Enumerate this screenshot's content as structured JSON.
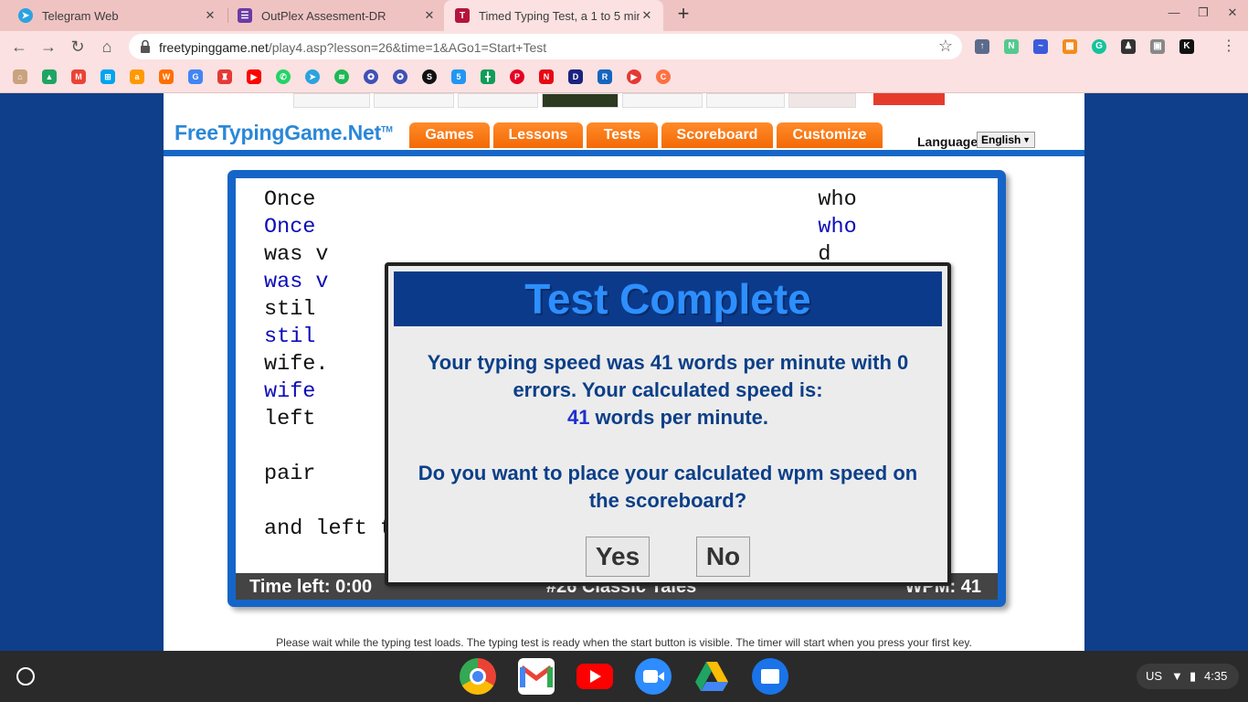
{
  "browser": {
    "tabs": [
      {
        "title": "Telegram Web",
        "icon": "telegram-icon",
        "color": "#2aa3e0",
        "active": false
      },
      {
        "title": "OutPlex Assesment-DR",
        "icon": "forms-icon",
        "color": "#6b3aa5",
        "active": false
      },
      {
        "title": "Timed Typing Test, a 1 to 5 minu",
        "icon": "typing-test-icon",
        "color": "#b5143c",
        "active": true
      }
    ],
    "url_domain": "freetypinggame.net",
    "url_path": "/play4.asp?lesson=26&time=1&AGo1=Start+Test"
  },
  "site": {
    "logo": "FreeTypingGame.Net",
    "logo_tm": "TM",
    "nav": [
      "Games",
      "Lessons",
      "Tests",
      "Scoreboard",
      "Customize"
    ],
    "language_label": "Language",
    "language_value": "English"
  },
  "typing": {
    "lines": [
      {
        "kind": "orig",
        "text": "Once                                       who"
      },
      {
        "kind": "typed",
        "text": "Once                                       who"
      },
      {
        "kind": "orig",
        "text": "was v                                      d"
      },
      {
        "kind": "typed",
        "text": "was v                                      d"
      },
      {
        "kind": "orig",
        "text": "stil                                       nd his"
      },
      {
        "kind": "typed",
        "text": "stil                                       nd his"
      },
      {
        "kind": "orig",
        "text": "wife.                                      g"
      },
      {
        "kind": "typed",
        "text": "wife                                        "
      },
      {
        "kind": "orig",
        "text": "left                                       e one"
      },
      {
        "kind": "orig",
        "text": "pair                                       itch,"
      },
      {
        "kind": "orig",
        "text": "and left them on the bench; then he said his prayers"
      }
    ],
    "status": {
      "time_left": "Time left: 0:00",
      "lesson": "#26 Classic Tales",
      "wpm": "WPM: 41"
    }
  },
  "dialog": {
    "title": "Test Complete",
    "line1": "Your typing speed was 41 words per minute with 0",
    "line2": "errors. Your calculated speed is:",
    "calc_speed": "41",
    "line3_suffix": " words per minute.",
    "question1": "Do you want to place your calculated wpm speed on",
    "question2": "the scoreboard?",
    "yes_label": "Yes",
    "no_label": "No"
  },
  "footer_message": "Please wait while the typing test loads. The typing test is ready when the start button is visible. The timer will start when you press your first key.",
  "shelf": {
    "apps": [
      "chrome-icon",
      "gmail-icon",
      "youtube-icon",
      "zoom-icon",
      "drive-icon",
      "files-icon"
    ],
    "locale": "US",
    "time": "4:35"
  }
}
